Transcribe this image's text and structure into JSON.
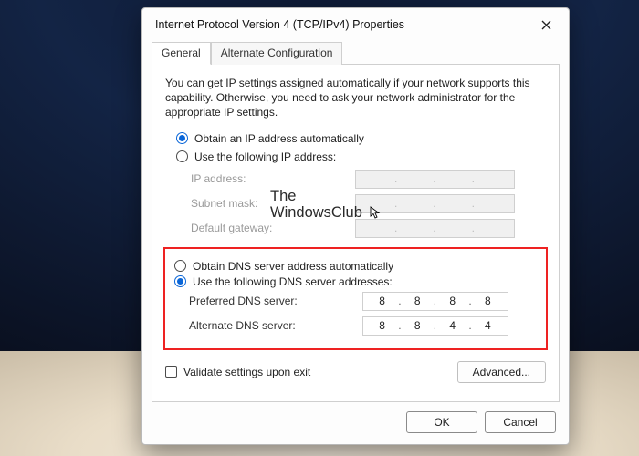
{
  "window": {
    "title": "Internet Protocol Version 4 (TCP/IPv4) Properties"
  },
  "tabs": {
    "general": "General",
    "alt": "Alternate Configuration"
  },
  "intro": "You can get IP settings assigned automatically if your network supports this capability. Otherwise, you need to ask your network administrator for the appropriate IP settings.",
  "ip": {
    "auto_label": "Obtain an IP address automatically",
    "manual_label": "Use the following IP address:",
    "fields": {
      "ip_label": "IP address:",
      "mask_label": "Subnet mask:",
      "gw_label": "Default gateway:"
    }
  },
  "dns": {
    "auto_label": "Obtain DNS server address automatically",
    "manual_label": "Use the following DNS server addresses:",
    "pref_label": "Preferred DNS server:",
    "alt_label": "Alternate DNS server:",
    "pref": [
      "8",
      "8",
      "8",
      "8"
    ],
    "alt": [
      "8",
      "8",
      "4",
      "4"
    ]
  },
  "validate_label": "Validate settings upon exit",
  "advanced_label": "Advanced...",
  "ok_label": "OK",
  "cancel_label": "Cancel",
  "watermark": {
    "line1": "The",
    "line2": "WindowsClub"
  }
}
